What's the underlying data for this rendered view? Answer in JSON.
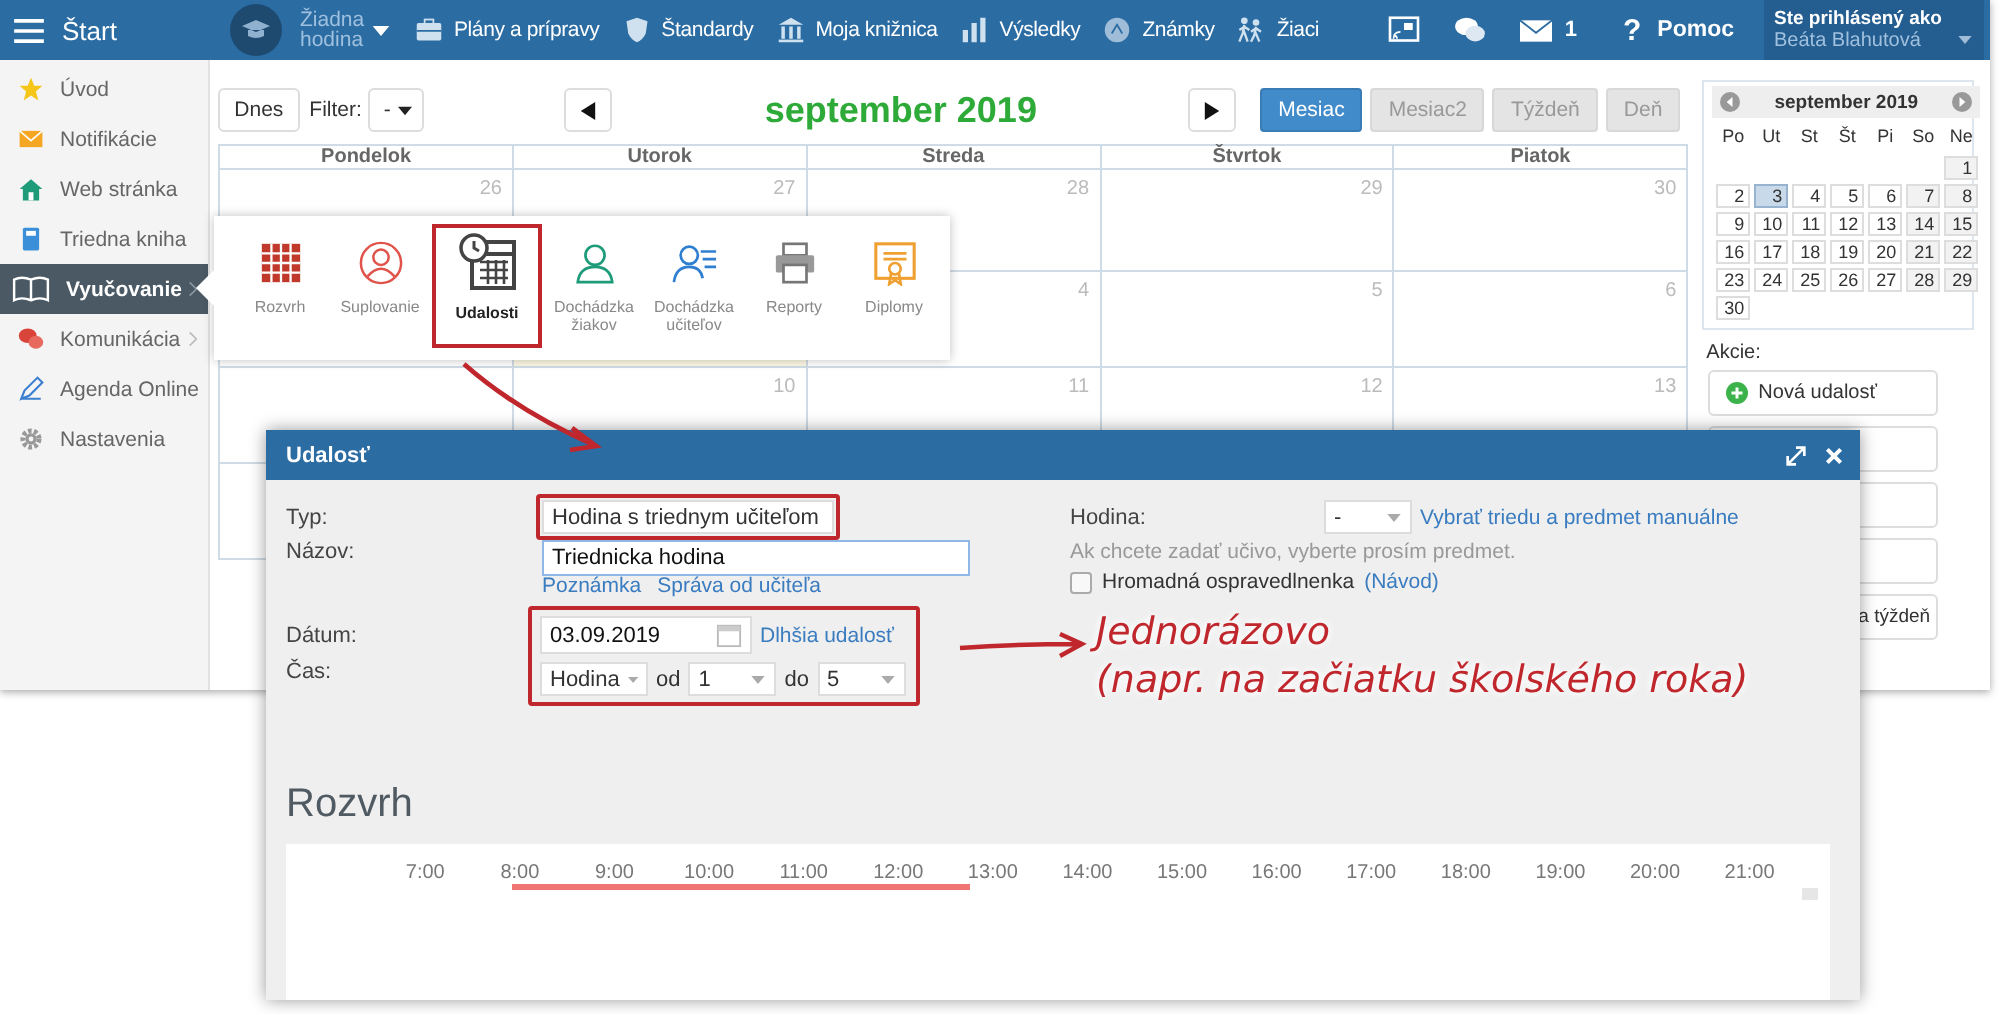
{
  "topbar": {
    "menu_label": "Štart",
    "lesson": "Žiadna hodina",
    "nav": [
      {
        "label": "Plány a prípravy",
        "kind": "briefcase"
      },
      {
        "label": "Štandardy",
        "kind": "shield"
      },
      {
        "label": "Moja knižnica",
        "kind": "library"
      },
      {
        "label": "Výsledky",
        "kind": "chart"
      },
      {
        "label": "Známky",
        "kind": "grade"
      },
      {
        "label": "Žiaci",
        "kind": "pupils"
      }
    ],
    "mail_count": "1",
    "help_icon": "?",
    "help_label": "Pomoc",
    "user_caption": "Ste prihlásený ako",
    "user_name": "Beáta Blahutová"
  },
  "sidebar": [
    {
      "label": "Úvod",
      "kind": "star",
      "selected": false,
      "submenu": false
    },
    {
      "label": "Notifikácie",
      "kind": "mail",
      "selected": false,
      "submenu": false
    },
    {
      "label": "Web stránka",
      "kind": "house",
      "selected": false,
      "submenu": false
    },
    {
      "label": "Triedna kniha",
      "kind": "book",
      "selected": false,
      "submenu": false
    },
    {
      "label": "Vyučovanie",
      "kind": "openbook",
      "selected": true,
      "submenu": true
    },
    {
      "label": "Komunikácia",
      "kind": "chat",
      "selected": false,
      "submenu": true
    },
    {
      "label": "Agenda Online",
      "kind": "pen",
      "selected": false,
      "submenu": false
    },
    {
      "label": "Nastavenia",
      "kind": "gear",
      "selected": false,
      "submenu": false
    }
  ],
  "calendar": {
    "today_button": "Dnes",
    "filter_label": "Filter:",
    "filter_value": "-",
    "title": "september 2019",
    "views": [
      {
        "label": "Mesiac",
        "selected": true
      },
      {
        "label": "Mesiac2",
        "selected": false
      },
      {
        "label": "Týždeň",
        "selected": false
      },
      {
        "label": "Deň",
        "selected": false
      }
    ],
    "weekdays": [
      "Pondelok",
      "Utorok",
      "Streda",
      "Štvrtok",
      "Piatok"
    ],
    "weeks": [
      [
        {
          "day": "26",
          "today": false
        },
        {
          "day": "27",
          "today": false
        },
        {
          "day": "28",
          "today": false
        },
        {
          "day": "29",
          "today": false
        },
        {
          "day": "30",
          "today": false
        }
      ],
      [
        {
          "today": false
        },
        {
          "today": true
        },
        {
          "day": "4",
          "today": false
        },
        {
          "day": "5",
          "today": false
        },
        {
          "day": "6",
          "today": false
        }
      ],
      [
        {
          "today": false
        },
        {
          "day": "10",
          "today": false
        },
        {
          "day": "11",
          "today": false
        },
        {
          "day": "12",
          "today": false
        },
        {
          "day": "13",
          "today": false
        }
      ]
    ]
  },
  "mini_calendar": {
    "title": "september 2019",
    "weekdays": [
      "Po",
      "Ut",
      "St",
      "Št",
      "Pi",
      "So",
      "Ne"
    ],
    "weeks": [
      {
        "kind": "end",
        "days": [
          {
            "day": "1",
            "selected": false
          }
        ]
      },
      {
        "kind": "full",
        "days": [
          {
            "day": "2",
            "selected": false
          },
          {
            "day": "3",
            "selected": true
          },
          {
            "day": "4",
            "selected": false
          },
          {
            "day": "5",
            "selected": false
          },
          {
            "day": "6",
            "selected": false
          },
          {
            "day": "7",
            "selected": false
          },
          {
            "day": "8",
            "selected": false
          }
        ]
      },
      {
        "kind": "full",
        "days": [
          {
            "day": "9",
            "selected": false
          },
          {
            "day": "10",
            "selected": false
          },
          {
            "day": "11",
            "selected": false
          },
          {
            "day": "12",
            "selected": false
          },
          {
            "day": "13",
            "selected": false
          },
          {
            "day": "14",
            "selected": false
          },
          {
            "day": "15",
            "selected": false
          }
        ]
      },
      {
        "kind": "full",
        "days": [
          {
            "day": "16",
            "selected": false
          },
          {
            "day": "17",
            "selected": false
          },
          {
            "day": "18",
            "selected": false
          },
          {
            "day": "19",
            "selected": false
          },
          {
            "day": "20",
            "selected": false
          },
          {
            "day": "21",
            "selected": false
          },
          {
            "day": "22",
            "selected": false
          }
        ]
      },
      {
        "kind": "full",
        "days": [
          {
            "day": "23",
            "selected": false
          },
          {
            "day": "24",
            "selected": false
          },
          {
            "day": "25",
            "selected": false
          },
          {
            "day": "26",
            "selected": false
          },
          {
            "day": "27",
            "selected": false
          },
          {
            "day": "28",
            "selected": false
          },
          {
            "day": "29",
            "selected": false
          }
        ]
      },
      {
        "kind": "start",
        "days": [
          {
            "day": "30",
            "selected": false
          }
        ]
      }
    ]
  },
  "actions": {
    "label": "Akcie:",
    "buttons": [
      {
        "label": "Nová udalosť",
        "kind": "add"
      },
      {
        "kind": "blank"
      },
      {
        "kind": "blank"
      },
      {
        "kind": "blank"
      },
      {
        "label": "a týždeň",
        "kind": "plain"
      }
    ]
  },
  "module_menu": [
    {
      "label": "Rozvrh",
      "kind": "grid",
      "selected": false
    },
    {
      "label": "Suplovanie",
      "kind": "swap",
      "selected": false
    },
    {
      "label": "Udalosti",
      "kind": "events",
      "selected": true
    },
    {
      "label": "Dochádzka žiakov",
      "kind": "person",
      "selected": false
    },
    {
      "label": "Dochádzka učiteľov",
      "kind": "personlist",
      "selected": false
    },
    {
      "label": "Reporty",
      "kind": "printer",
      "selected": false
    },
    {
      "label": "Diplomy",
      "kind": "diploma",
      "selected": false
    }
  ],
  "dialog": {
    "title": "Udalosť",
    "type": {
      "label": "Typ:",
      "value": "Hodina s triednym učiteľom",
      "highlighted": true
    },
    "name": {
      "label": "Názov:",
      "value": "Triednicka hodina"
    },
    "links": [
      "Poznámka",
      "Správa od učiteľa"
    ],
    "date": {
      "label": "Dátum:",
      "value": "03.09.2019",
      "link": "Dlhšia udalosť"
    },
    "time": {
      "label": "Čas:",
      "unit": "Hodina",
      "from_label": "od",
      "from": "1",
      "to_label": "do",
      "to": "5"
    },
    "datetime_highlighted": true,
    "lesson": {
      "label": "Hodina:",
      "value": "-",
      "link": "Vybrať triedu a predmet manuálne",
      "hint": "Ak chcete zadať učivo, vyberte prosím predmet."
    },
    "bulk_excuse": {
      "label": "Hromadná ospravedlnenka",
      "checked": false,
      "link": "(Návod)"
    },
    "schedule": {
      "title": "Rozvrh",
      "hours": [
        "7:00",
        "8:00",
        "9:00",
        "10:00",
        "11:00",
        "12:00",
        "13:00",
        "14:00",
        "15:00",
        "16:00",
        "17:00",
        "18:00",
        "19:00",
        "20:00",
        "21:00"
      ]
    }
  },
  "callout": {
    "lines": [
      "Jednorázovo",
      "(napr. na začiatku školského roka)"
    ]
  }
}
